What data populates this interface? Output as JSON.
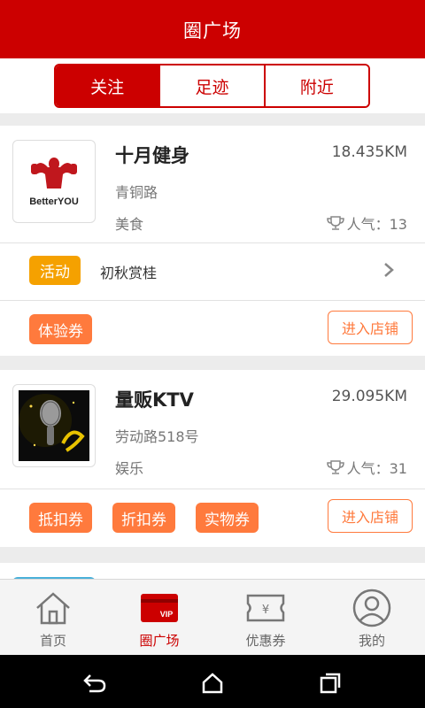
{
  "header": {
    "title": "圈广场"
  },
  "tabs": [
    {
      "label": "关注",
      "active": true
    },
    {
      "label": "足迹",
      "active": false
    },
    {
      "label": "附近",
      "active": false
    }
  ],
  "stores": [
    {
      "name": "十月健身",
      "distance": "18.435KM",
      "address": "青铜路",
      "category": "美食",
      "popularity": "人气：13",
      "logo_text": "BetterYOU",
      "activity": {
        "badge": "活动",
        "text": "初秋赏桂"
      },
      "coupons": [
        "体验券"
      ],
      "enter_label": "进入店铺"
    },
    {
      "name": "量贩KTV",
      "distance": "29.095KM",
      "address": "劳动路518号",
      "category": "娱乐",
      "popularity": "人气：31",
      "coupons": [
        "抵扣券",
        "折扣券",
        "实物券"
      ],
      "enter_label": "进入店铺"
    }
  ],
  "bottom_nav": [
    {
      "label": "首页",
      "icon": "home-icon",
      "active": false
    },
    {
      "label": "圈广场",
      "icon": "vip-card-icon",
      "active": true,
      "icon_text": "VIP"
    },
    {
      "label": "优惠券",
      "icon": "coupon-ticket-icon",
      "active": false,
      "icon_text": "¥"
    },
    {
      "label": "我的",
      "icon": "user-profile-icon",
      "active": false
    }
  ],
  "colors": {
    "brand": "#cc0000",
    "coupon": "#ff7a3d",
    "activity": "#f5a100"
  }
}
